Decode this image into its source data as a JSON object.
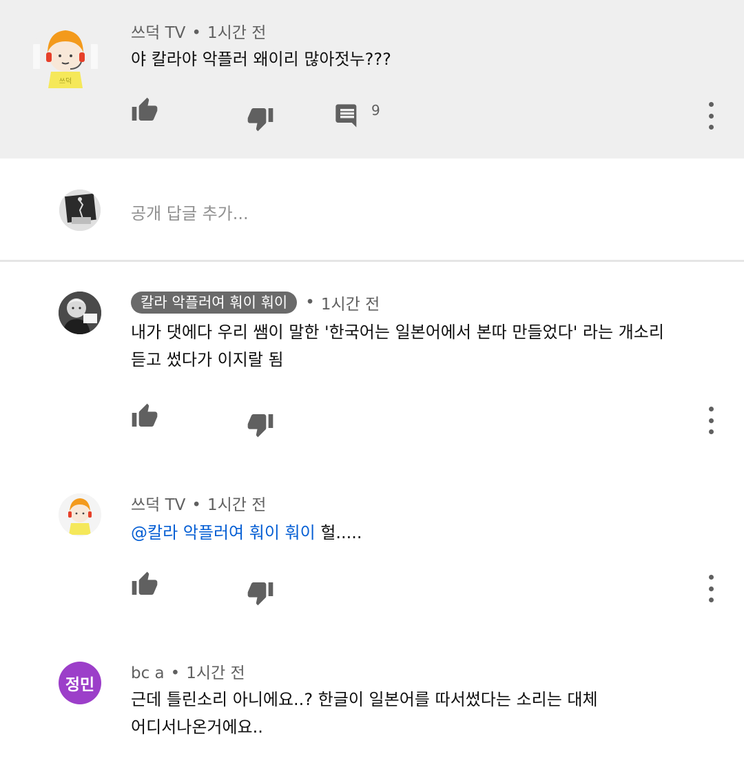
{
  "comments": [
    {
      "author": "쓰덕 TV",
      "time": "1시간 전",
      "text": "야 칼라야 악플러 왜이리 많아젓누???",
      "reply_count": "9"
    },
    {
      "author": "칼라 악플러여 훠이 훠이",
      "time": "1시간 전",
      "text_line1": "내가 댓에다 우리 쌤이 말한 '한국어는 일본어에서 본따 만들었다' 라는 개소리",
      "text_line2": "듣고 썼다가 이지랄 됨"
    },
    {
      "author": "쓰덕 TV",
      "time": "1시간 전",
      "mention": "@칼라 악플러여 훠이 훠이",
      "text": " 헐....."
    },
    {
      "author": "bc a",
      "time": "1시간 전",
      "avatar_initials": "정민",
      "text_line1": "근데 틀린소리 아니에요..? 한글이 일본어를 따서썼다는 소리는 대체",
      "text_line2": "어디서나온거에요.."
    }
  ],
  "reply_box": {
    "placeholder": "공개 답글 추가..."
  },
  "meta_separator": "•",
  "colors": {
    "highlight_bg": "#efefef",
    "mention": "#065fd4",
    "initials_avatar": "#9c3fc9",
    "chip_bg": "#6a6a6a"
  },
  "icons": [
    "thumb-up-icon",
    "thumb-down-icon",
    "comment-icon",
    "more-vert-icon"
  ]
}
